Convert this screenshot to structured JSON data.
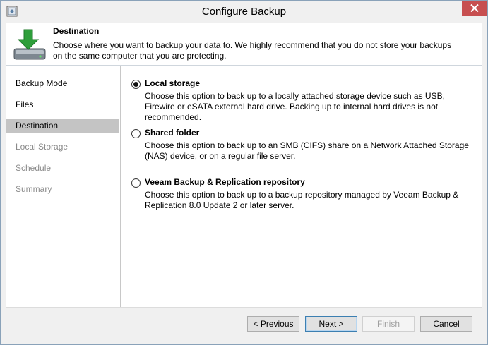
{
  "window": {
    "title": "Configure Backup"
  },
  "header": {
    "title": "Destination",
    "description": "Choose where you want to backup your data to. We highly recommend that you do not store your backups on the same computer that you are protecting."
  },
  "sidebar": {
    "items": [
      {
        "label": "Backup Mode",
        "state": "normal"
      },
      {
        "label": "Files",
        "state": "normal"
      },
      {
        "label": "Destination",
        "state": "active"
      },
      {
        "label": "Local Storage",
        "state": "disabled"
      },
      {
        "label": "Schedule",
        "state": "disabled"
      },
      {
        "label": "Summary",
        "state": "disabled"
      }
    ]
  },
  "options": [
    {
      "label": "Local storage",
      "description": "Choose this option to back up to a locally attached storage device such as USB, Firewire or eSATA external hard drive. Backing up to internal hard drives is not recommended.",
      "selected": true
    },
    {
      "label": "Shared folder",
      "description": "Choose this option to back up to an SMB (CIFS) share on a Network Attached Storage (NAS) device, or on a regular file server.",
      "selected": false
    },
    {
      "label": "Veeam Backup & Replication repository",
      "description": "Choose this option to back up to a backup repository managed by Veeam Backup & Replication 8.0 Update 2 or later server.",
      "selected": false
    }
  ],
  "footer": {
    "previous_label": "< Previous",
    "next_label": "Next >",
    "finish_label": "Finish",
    "cancel_label": "Cancel"
  },
  "colors": {
    "close_button": "#c74f50",
    "active_nav": "#c4c4c4",
    "header_arrow": "#2e9e3a"
  }
}
